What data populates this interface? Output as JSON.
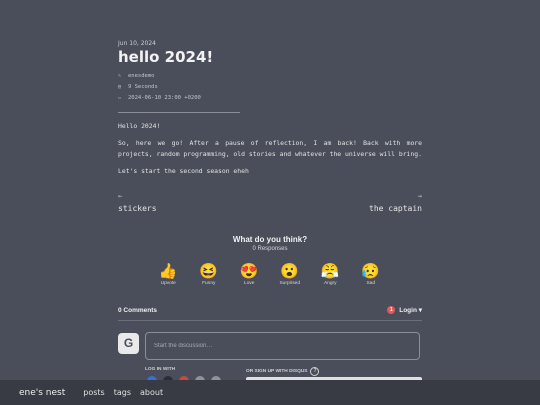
{
  "post": {
    "date": "Jun 10, 2024",
    "title": "hello 2024!",
    "author": "enesdemo",
    "reading_time": "9 Seconds",
    "datetime": "2024-06-10 23:00 +0200",
    "paragraphs": [
      "Hello 2024!",
      "So, here we go! After a pause of reflection, I am back! Back with more projects, random programming, old stories and whatever the universe will bring.",
      "Let's start the second season eheh"
    ]
  },
  "post_nav": {
    "prev_arrow": "←",
    "prev_label": "stickers",
    "next_arrow": "→",
    "next_label": "the captain"
  },
  "reactions": {
    "title": "What do you think?",
    "subtitle": "0 Responses",
    "items": [
      {
        "label": "Upvote",
        "icon": "👍"
      },
      {
        "label": "Funny",
        "icon": "😆"
      },
      {
        "label": "Love",
        "icon": "😍"
      },
      {
        "label": "Surprised",
        "icon": "😮"
      },
      {
        "label": "Angry",
        "icon": "😤"
      },
      {
        "label": "Sad",
        "icon": "😥"
      }
    ]
  },
  "comments": {
    "count_label": "0 Comments",
    "login_badge": "1",
    "login_label": "Login ▾",
    "avatar_letter": "G",
    "placeholder": "Start the discussion…",
    "login_with": "LOG IN WITH",
    "signup_label": "OR SIGN UP WITH DISQUS",
    "help_icon": "?"
  },
  "footer": {
    "brand": "ene's nest",
    "links": [
      "posts",
      "tags",
      "about"
    ]
  },
  "colors": {
    "background": "#4a4e5a",
    "footer": "#383b44",
    "badge": "#e05a5a"
  }
}
